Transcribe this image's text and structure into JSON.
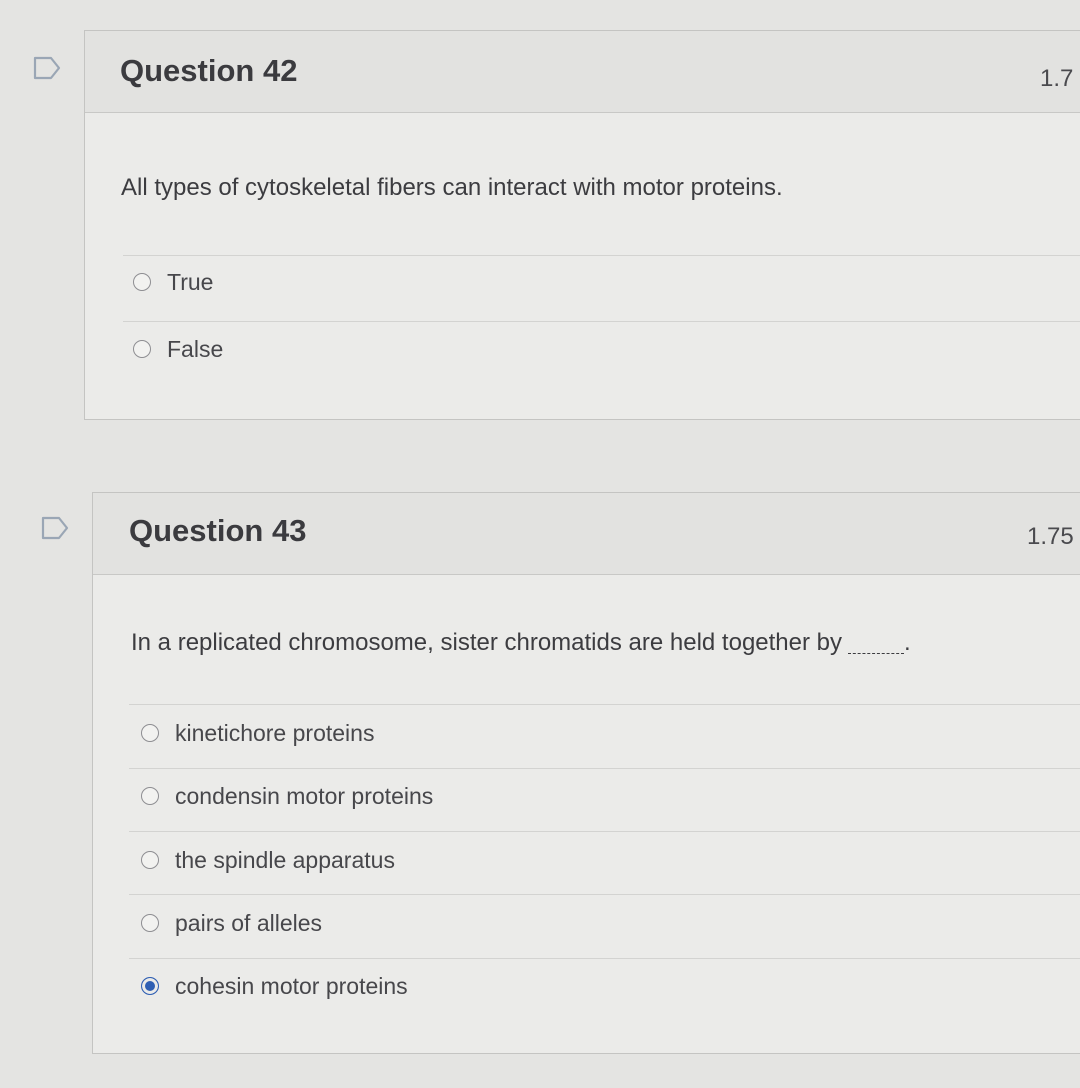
{
  "questions": [
    {
      "title": "Question 42",
      "points": "1.7",
      "text": "All types of cytoskeletal fibers can interact with motor proteins.",
      "options": [
        {
          "label": "True",
          "selected": false
        },
        {
          "label": "False",
          "selected": false
        }
      ]
    },
    {
      "title": "Question 43",
      "points": "1.75",
      "text": "In a replicated chromosome, sister chromatids are held together by",
      "blank_suffix": ".",
      "options": [
        {
          "label": "kinetichore proteins",
          "selected": false
        },
        {
          "label": "condensin motor proteins",
          "selected": false
        },
        {
          "label": "the spindle apparatus",
          "selected": false
        },
        {
          "label": "pairs of alleles",
          "selected": false
        },
        {
          "label": "cohesin motor proteins",
          "selected": true
        }
      ]
    }
  ],
  "icons": {
    "flag": "flag-outline-icon",
    "radio_unselected": "radio-unchecked-icon",
    "radio_selected": "radio-checked-icon"
  },
  "colors": {
    "accent": "#2f5fb3",
    "background": "#e4e4e2",
    "card": "#ebebe9"
  }
}
